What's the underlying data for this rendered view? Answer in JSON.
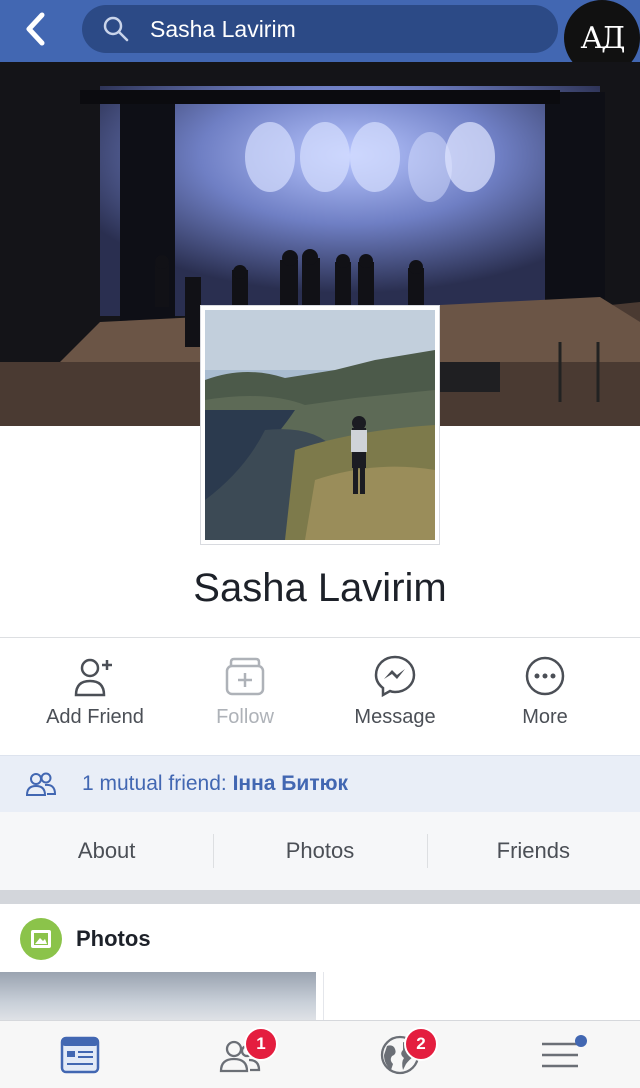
{
  "header": {
    "search_text": "Sasha Lavirim",
    "logo_text": "АД"
  },
  "profile": {
    "name": "Sasha Lavirim"
  },
  "actions": [
    {
      "label": "Add Friend",
      "icon": "add-friend-icon"
    },
    {
      "label": "Follow",
      "icon": "follow-icon",
      "disabled": true
    },
    {
      "label": "Message",
      "icon": "messenger-icon"
    },
    {
      "label": "More",
      "icon": "more-icon"
    }
  ],
  "mutual": {
    "prefix": "1 mutual friend: ",
    "friend_name": "Інна Битюк"
  },
  "tabs": [
    {
      "label": "About"
    },
    {
      "label": "Photos"
    },
    {
      "label": "Friends"
    }
  ],
  "photos_section": {
    "title": "Photos"
  },
  "bottom_nav": {
    "friends_badge": "1",
    "notifications_badge": "2"
  },
  "colors": {
    "brand": "#4267b2",
    "badge": "#e41e3f",
    "mutual_bg": "#e9eef7"
  }
}
